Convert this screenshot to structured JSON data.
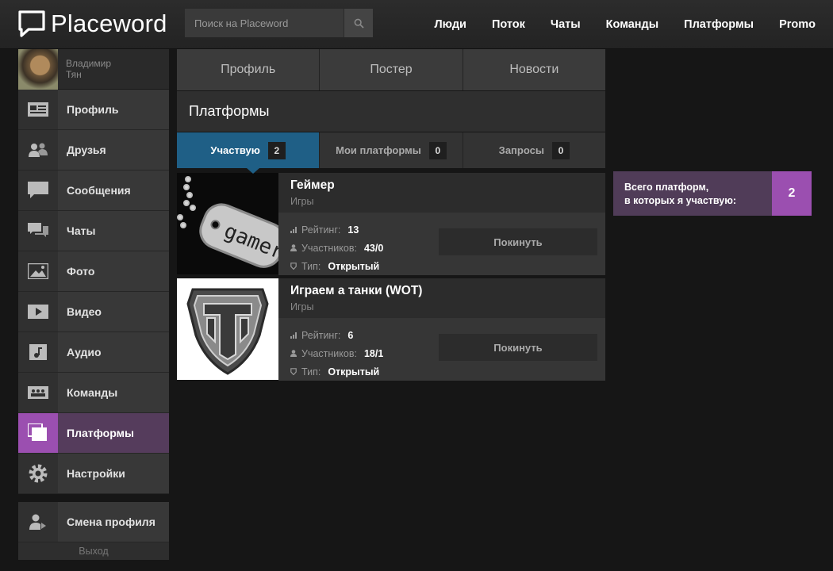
{
  "header": {
    "logo": "Placeword",
    "search_placeholder": "Поиск на Placeword",
    "nav": [
      "Люди",
      "Поток",
      "Чаты",
      "Команды",
      "Платформы",
      "Promo"
    ]
  },
  "sidebar": {
    "user": {
      "first_name": "Владимир",
      "last_name": "Тян"
    },
    "items": [
      {
        "label": "Профиль",
        "icon": "profile-card-icon"
      },
      {
        "label": "Друзья",
        "icon": "friends-icon"
      },
      {
        "label": "Сообщения",
        "icon": "message-icon"
      },
      {
        "label": "Чаты",
        "icon": "chats-icon"
      },
      {
        "label": "Фото",
        "icon": "photo-icon"
      },
      {
        "label": "Видео",
        "icon": "video-play-icon"
      },
      {
        "label": "Аудио",
        "icon": "music-note-icon"
      },
      {
        "label": "Команды",
        "icon": "teams-icon"
      },
      {
        "label": "Платформы",
        "icon": "platforms-icon",
        "active": true
      },
      {
        "label": "Настройки",
        "icon": "gear-icon"
      }
    ],
    "switch_profile": "Смена профиля",
    "logout": "Выход"
  },
  "main": {
    "top_tabs": [
      "Профиль",
      "Постер",
      "Новости"
    ],
    "title": "Платформы",
    "subtabs": [
      {
        "label": "Участвую",
        "count": "2",
        "active": true
      },
      {
        "label": "Мои платформы",
        "count": "0"
      },
      {
        "label": "Запросы",
        "count": "0"
      }
    ],
    "labels": {
      "rating": "Рейтинг:",
      "members": "Участников:",
      "type": "Тип:",
      "leave": "Покинуть"
    },
    "platforms": [
      {
        "name": "Геймер",
        "category": "Игры",
        "rating": "13",
        "members": "43/0",
        "type": "Открытый",
        "image": "gamer-dogtag-image"
      },
      {
        "name": "Играем а танки (WOT)",
        "category": "Игры",
        "rating": "6",
        "members": "18/1",
        "type": "Открытый",
        "image": "wot-logo-image"
      }
    ]
  },
  "stats": {
    "label_line1": "Всего платформ,",
    "label_line2": "в которых я участвую:",
    "value": "2"
  },
  "colors": {
    "accent_purple": "#9b4fb0",
    "accent_blue": "#1f5f86"
  }
}
